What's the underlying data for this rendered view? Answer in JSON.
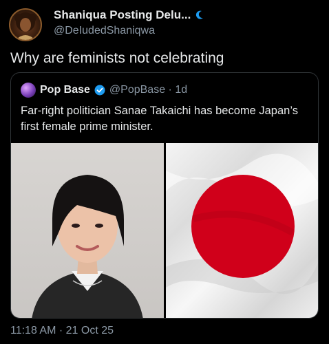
{
  "author": {
    "display_name": "Shaniqua Posting Delu...",
    "handle": "@DeIudedShaniqwa"
  },
  "tweet": {
    "text": "Why are feminists not celebrating",
    "timestamp": "11:18 AM · 21 Oct 25"
  },
  "quote": {
    "name": "Pop Base",
    "handle": "@PopBase · 1d",
    "text": "Far-right politician Sanae Takaichi has become Japan’s first female prime minister."
  },
  "icons": {
    "author_badge": "moon-icon",
    "verified": "verified-badge-icon"
  },
  "colors": {
    "background": "#000000",
    "verified_blue": "#1d9bf0",
    "flag_red": "#d0001a"
  }
}
